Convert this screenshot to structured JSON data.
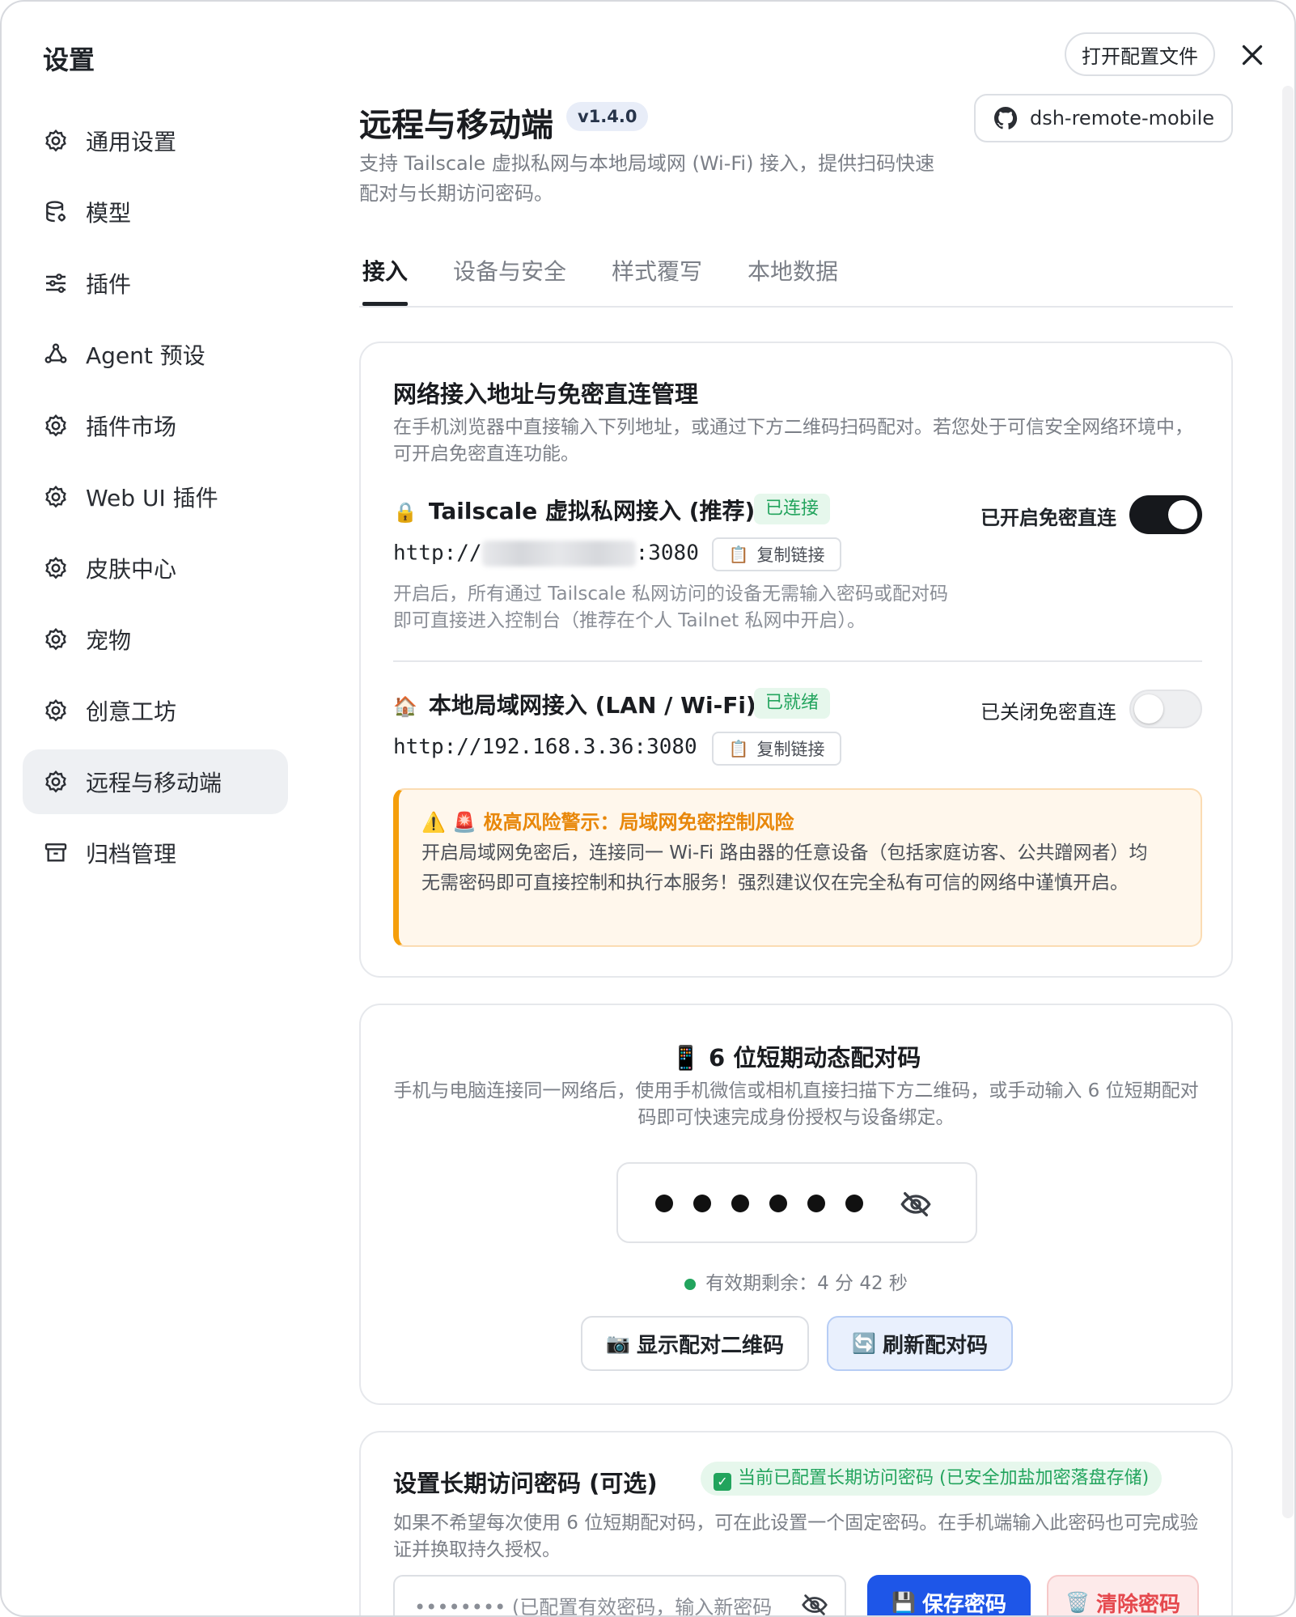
{
  "window": {
    "title": "设置",
    "open_config_label": "打开配置文件"
  },
  "sidebar": {
    "items": [
      {
        "label": "通用设置",
        "icon": "gear-icon"
      },
      {
        "label": "模型",
        "icon": "database-icon"
      },
      {
        "label": "插件",
        "icon": "sliders-icon"
      },
      {
        "label": "Agent 预设",
        "icon": "agent-icon"
      },
      {
        "label": "插件市场",
        "icon": "gear-icon"
      },
      {
        "label": "Web UI 插件",
        "icon": "gear-icon"
      },
      {
        "label": "皮肤中心",
        "icon": "gear-icon"
      },
      {
        "label": "宠物",
        "icon": "gear-icon"
      },
      {
        "label": "创意工坊",
        "icon": "gear-icon"
      },
      {
        "label": "远程与移动端",
        "icon": "gear-icon",
        "active": true
      },
      {
        "label": "归档管理",
        "icon": "archive-icon"
      }
    ]
  },
  "header": {
    "title": "远程与移动端",
    "version": "v1.4.0",
    "repo": "dsh-remote-mobile",
    "description": "支持 Tailscale 虚拟私网与本地局域网 (Wi-Fi) 接入，提供扫码快速配对与长期访问密码。"
  },
  "tabs": [
    "接入",
    "设备与安全",
    "样式覆写",
    "本地数据"
  ],
  "network": {
    "title": "网络接入地址与免密直连管理",
    "description": "在手机浏览器中直接输入下列地址，或通过下方二维码扫码配对。若您处于可信安全网络环境中，可开启免密直连功能。",
    "tailscale": {
      "emoji": "🔒",
      "title": "Tailscale 虚拟私网接入 (推荐)",
      "status": "已连接",
      "url_prefix": "http://",
      "url_suffix": ":3080",
      "copy_label": "复制链接",
      "toggle_label": "已开启免密直连",
      "toggle_on": true,
      "note": "开启后，所有通过 Tailscale 私网访问的设备无需输入密码或配对码即可直接进入控制台（推荐在个人 Tailnet 私网中开启）。"
    },
    "lan": {
      "emoji": "🏠",
      "title": "本地局域网接入 (LAN / Wi-Fi)",
      "status": "已就绪",
      "url": "http://192.168.3.36:3080",
      "copy_label": "复制链接",
      "toggle_label": "已关闭免密直连",
      "toggle_on": false
    },
    "warning": {
      "title": "⚠️ 🚨 极高风险警示：局域网免密控制风险",
      "body": "开启局域网免密后，连接同一 Wi-Fi 路由器的任意设备（包括家庭访客、公共蹭网者）均无需密码即可直接控制和执行本服务！强烈建议仅在完全私有可信的网络中谨慎开启。"
    }
  },
  "pairing": {
    "title": "📱 6 位短期动态配对码",
    "description": "手机与电脑连接同一网络后，使用手机微信或相机直接扫描下方二维码，或手动输入 6 位短期配对码即可快速完成身份授权与设备绑定。",
    "masked_digits": 6,
    "expiry": "有效期剩余：4 分 42 秒",
    "show_qr_label": "显示配对二维码",
    "refresh_label": "刷新配对码"
  },
  "password": {
    "title": "设置长期访问密码 (可选)",
    "status": "当前已配置长期访问密码 (已安全加盐加密落盘存储)",
    "description": "如果不希望每次使用 6 位短期配对码，可在此设置一个固定密码。在手机端输入此密码也可完成验证并换取持久授权。",
    "placeholder": "••••••••  (已配置有效密码，输入新密码",
    "save_label": "保存密码",
    "clear_label": "清除密码"
  },
  "colors": {
    "accent": "#1e56e8",
    "success": "#22a45d",
    "warning": "#f59e0b",
    "danger": "#e5484d"
  }
}
